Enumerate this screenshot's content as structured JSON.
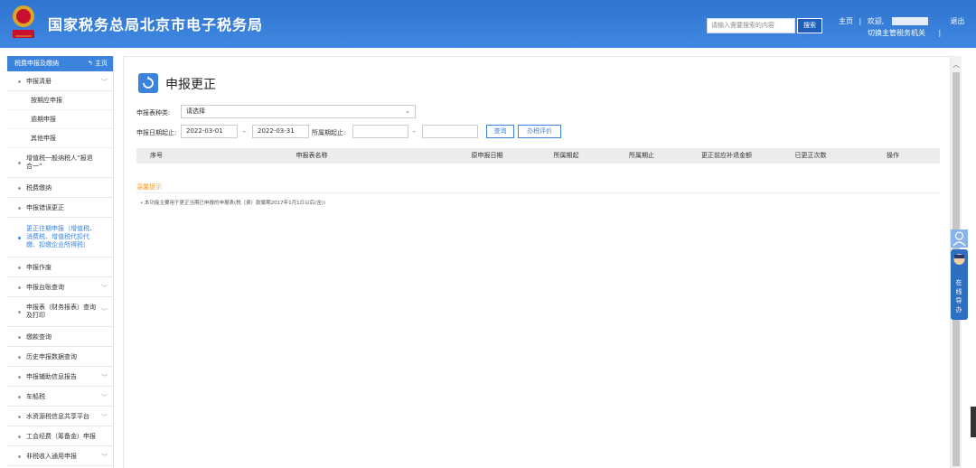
{
  "header": {
    "title": "国家税务总局北京市电子税务局",
    "search_placeholder": "请输入需要搜索的内容",
    "search_button": "搜索",
    "home_link": "主页",
    "welcome": "欢迎,",
    "logout": "退出",
    "switch_org": "切换主管税务机关"
  },
  "sidebar": {
    "head_label": "税费申报及缴纳",
    "home_label": "主页",
    "items": [
      {
        "label": "申报清册",
        "expandable": true
      },
      {
        "label": "增值税一般纳税人“报退合一”",
        "expandable": false
      },
      {
        "label": "税费缴纳",
        "expandable": false
      },
      {
        "label": "申报错误更正",
        "expandable": false
      },
      {
        "label": "更正往期申报（增值税、消费税、增值税代扣代缴、扣缴企业所得税）",
        "expandable": false,
        "active": true
      },
      {
        "label": "申报作废",
        "expandable": false
      },
      {
        "label": "申报台账查询",
        "expandable": true
      },
      {
        "label": "申报表（财务报表）查询及打印",
        "expandable": true
      },
      {
        "label": "缴款查询",
        "expandable": false
      },
      {
        "label": "历史申报数据查询",
        "expandable": false
      },
      {
        "label": "申报辅助信息报告",
        "expandable": true
      },
      {
        "label": "车船税",
        "expandable": true
      },
      {
        "label": "水资源税信息共享平台",
        "expandable": true
      },
      {
        "label": "工会经费（筹备金）申报",
        "expandable": false
      },
      {
        "label": "非税收入通用申报",
        "expandable": true
      }
    ],
    "subitems": [
      "按期应申报",
      "逾期申报",
      "其他申报"
    ]
  },
  "main": {
    "page_title": "申报更正",
    "report_type_label": "申报表种类:",
    "report_type_value": "请选择",
    "date_label": "申报日期起止:",
    "date_start": "2022-03-01",
    "date_end": "2022-03-31",
    "period_label": "所属期起止:",
    "period_start": "",
    "period_end": "",
    "dash": "-",
    "query_button": "查询",
    "rate_button": "办税评价",
    "columns": [
      "序号",
      "申报表名称",
      "原申报日期",
      "所属期起",
      "所属期止",
      "更正前应补退金额",
      "已更正次数",
      "操作"
    ],
    "tips_title": "温馨提示",
    "tips_text": "• 本功能主要用于更正当期已申报的申报表(税（费）款属期2017年1月1日以后(含))"
  },
  "float_service": {
    "label": "在线导办"
  },
  "colors": {
    "header_blue": "#3a7dd8",
    "accent": "#3b83dc",
    "tips_orange": "#f59a23"
  }
}
